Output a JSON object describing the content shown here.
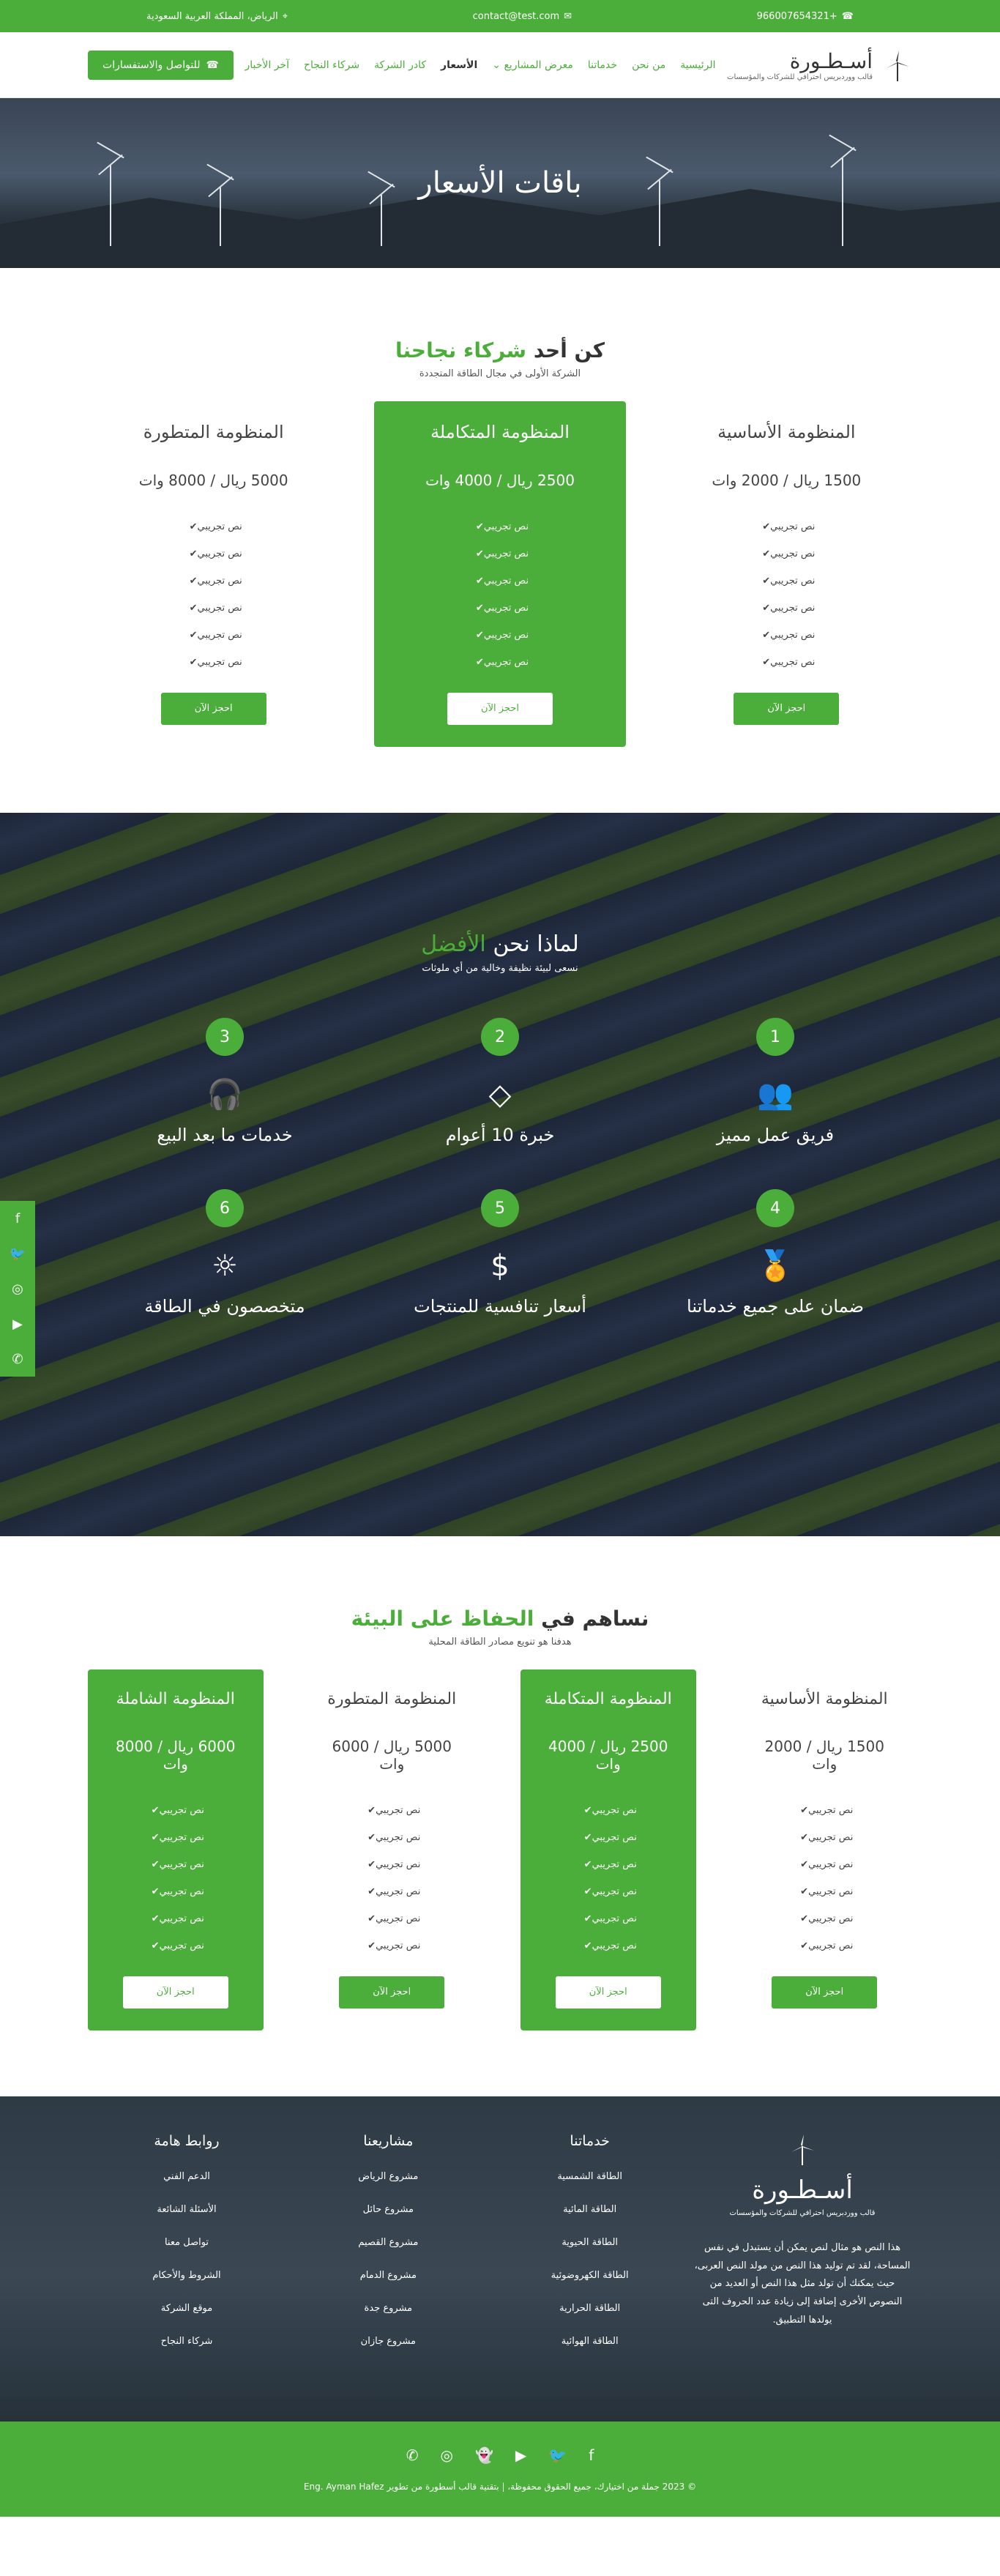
{
  "topbar": {
    "phone": "+966007654321",
    "email": "contact@test.com",
    "location": "الرياض، المملكة العربية السعودية"
  },
  "brand": {
    "name": "أسـطـورة",
    "tagline": "قالب ووردبريس احترافي للشركات والمؤسسات"
  },
  "nav": {
    "items": [
      "الرئيسية",
      "من نحن",
      "خدماتنا",
      "معرض المشاريع",
      "الأسعار",
      "كادر الشركة",
      "شركاء النجاح",
      "آخر الأخبار"
    ],
    "cta": "للتواصل والاستفسارات"
  },
  "hero": {
    "title": "باقات الأسعار"
  },
  "pricing1": {
    "title_prefix": "كن أحد",
    "title_highlight": "شركاء نجاحنا",
    "subtitle": "الشركة الأولى في مجال الطاقة المتجددة",
    "plans": [
      {
        "name": "المنظومة الأساسية",
        "price": "1500 ريال / 2000 وات",
        "features": [
          "نص تجريبي",
          "نص تجريبي",
          "نص تجريبي",
          "نص تجريبي",
          "نص تجريبي",
          "نص تجريبي"
        ],
        "button": "احجز الآن"
      },
      {
        "name": "المنظومة المتكاملة",
        "price": "2500 ريال / 4000 وات",
        "features": [
          "نص تجريبي",
          "نص تجريبي",
          "نص تجريبي",
          "نص تجريبي",
          "نص تجريبي",
          "نص تجريبي"
        ],
        "button": "احجز الآن"
      },
      {
        "name": "المنظومة المتطورة",
        "price": "5000 ريال / 8000 وات",
        "features": [
          "نص تجريبي",
          "نص تجريبي",
          "نص تجريبي",
          "نص تجريبي",
          "نص تجريبي",
          "نص تجريبي"
        ],
        "button": "احجز الآن"
      }
    ]
  },
  "why": {
    "title_prefix": "لماذا نحن",
    "title_highlight": "الأفضل",
    "subtitle": "نسعى لبيئة نظيفة وخالية من أي ملوثات",
    "features": [
      {
        "num": "1",
        "label": "فريق عمل مميز",
        "icon": "team-icon"
      },
      {
        "num": "2",
        "label": "خبرة 10 أعوام",
        "icon": "diamond-icon"
      },
      {
        "num": "3",
        "label": "خدمات ما بعد البيع",
        "icon": "headset-icon"
      },
      {
        "num": "4",
        "label": "ضمان على جميع خدماتنا",
        "icon": "award-icon"
      },
      {
        "num": "5",
        "label": "أسعار تنافسية للمنتجات",
        "icon": "dollar-icon"
      },
      {
        "num": "6",
        "label": "متخصصون في الطاقة",
        "icon": "sun-icon"
      }
    ]
  },
  "pricing2": {
    "title_prefix": "نساهم في",
    "title_highlight": "الحفاظ على البيئة",
    "subtitle": "هدفنا هو تنويع مصادر الطاقة المحلية",
    "plans": [
      {
        "name": "المنظومة الأساسية",
        "price": "1500 ريال / 2000 وات",
        "features": [
          "نص تجريبي",
          "نص تجريبي",
          "نص تجريبي",
          "نص تجريبي",
          "نص تجريبي",
          "نص تجريبي"
        ],
        "button": "احجز الآن"
      },
      {
        "name": "المنظومة المتكاملة",
        "price": "2500 ريال / 4000 وات",
        "features": [
          "نص تجريبي",
          "نص تجريبي",
          "نص تجريبي",
          "نص تجريبي",
          "نص تجريبي",
          "نص تجريبي"
        ],
        "button": "احجز الآن"
      },
      {
        "name": "المنظومة المتطورة",
        "price": "5000 ريال / 6000 وات",
        "features": [
          "نص تجريبي",
          "نص تجريبي",
          "نص تجريبي",
          "نص تجريبي",
          "نص تجريبي",
          "نص تجريبي"
        ],
        "button": "احجز الآن"
      },
      {
        "name": "المنظومة الشاملة",
        "price": "6000 ريال / 8000 وات",
        "features": [
          "نص تجريبي",
          "نص تجريبي",
          "نص تجريبي",
          "نص تجريبي",
          "نص تجريبي",
          "نص تجريبي"
        ],
        "button": "احجز الآن"
      }
    ]
  },
  "footer": {
    "brand_name": "أسـطـورة",
    "brand_tagline": "قالب ووردبريس احترافي للشركات والمؤسسات",
    "about": "هذا النص هو مثال لنص يمكن أن يستبدل في نفس المساحة، لقد تم توليد هذا النص من مولد النص العربى، حيث يمكنك أن تولد مثل هذا النص أو العديد من النصوص الأخرى إضافة إلى زيادة عدد الحروف التى يولدها التطبيق.",
    "columns": [
      {
        "title": "خدماتنا",
        "links": [
          "الطاقة الشمسية",
          "الطاقة المائية",
          "الطاقة الحيوية",
          "الطاقة الكهروضوئية",
          "الطاقة الحرارية",
          "الطاقة الهوائية"
        ]
      },
      {
        "title": "مشاريعنا",
        "links": [
          "مشروع الرياض",
          "مشروع حائل",
          "مشروع القصيم",
          "مشروع الدمام",
          "مشروع جدة",
          "مشروع جازان"
        ]
      },
      {
        "title": "روابط هامة",
        "links": [
          "الدعم الفني",
          "الأسئلة الشائعة",
          "تواصل معنا",
          "الشروط والأحكام",
          "موقع الشركة",
          "شركاء النجاح"
        ]
      }
    ],
    "copyright": "© 2023 جملة من اختيارك، جميع الحقوق محفوظة، | بتقنية قالب أسطورة من تطوير Eng. Ayman Hafez"
  },
  "colors": {
    "accent": "#4cae3a"
  }
}
